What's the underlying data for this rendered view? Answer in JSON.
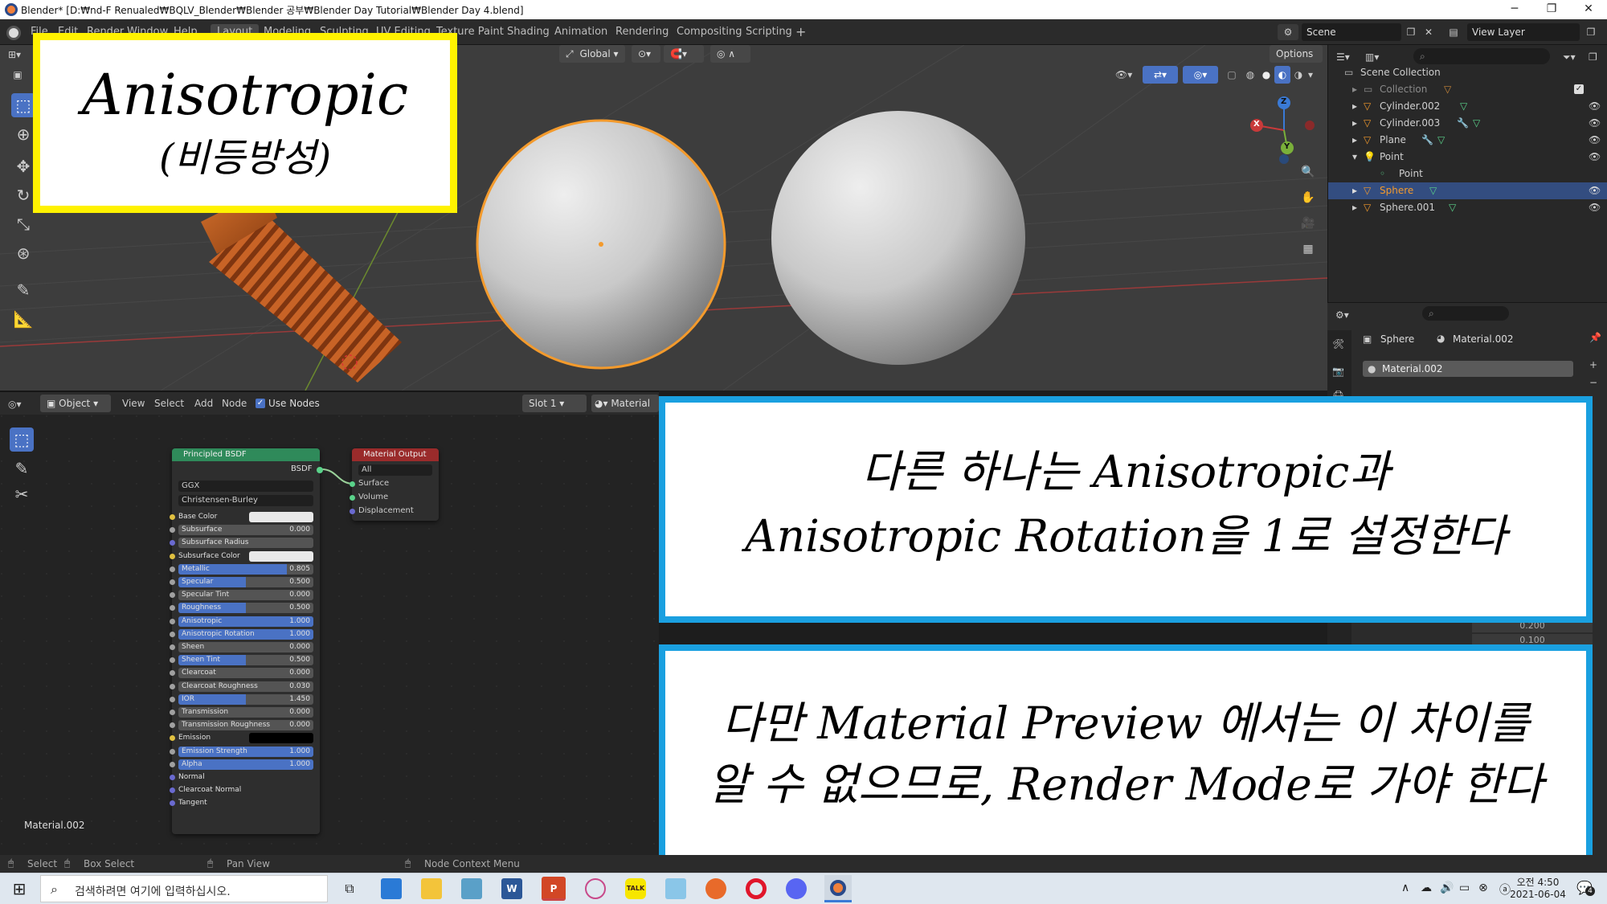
{
  "window": {
    "title": "Blender* [D:₩nd-F Renualed₩BQLV_Blender₩Blender 공부₩Blender Day Tutorial₩Blender Day 4.blend]",
    "minimize": "─",
    "maximize": "❐",
    "close": "✕"
  },
  "topbar": {
    "menus": [
      "File",
      "Edit",
      "Render",
      "Window",
      "Help"
    ],
    "workspaces": [
      "Layout",
      "Modeling",
      "Sculpting",
      "UV Editing",
      "Texture Paint",
      "Shading",
      "Animation",
      "Rendering",
      "Compositing",
      "Scripting"
    ],
    "add_tab": "+",
    "scene": "Scene",
    "view_layer": "View Layer"
  },
  "viewport": {
    "transform_orientation": "Global",
    "options": "Options",
    "gizmo": {
      "x": "X",
      "y": "Y",
      "z": "Z"
    }
  },
  "outliner": {
    "items": [
      {
        "label": "Scene Collection"
      },
      {
        "label": "Collection"
      },
      {
        "label": "Cylinder.002"
      },
      {
        "label": "Cylinder.003"
      },
      {
        "label": "Plane"
      },
      {
        "label": "Point"
      },
      {
        "label": "Point"
      },
      {
        "label": "Sphere"
      },
      {
        "label": "Sphere.001"
      }
    ]
  },
  "properties": {
    "object": "Sphere",
    "material": "Material.002",
    "slot": "Material.002",
    "values": [
      "0.200",
      "0.100"
    ]
  },
  "node_editor": {
    "mode": "Object",
    "menus": [
      "View",
      "Select",
      "Add",
      "Node"
    ],
    "use_nodes": "Use Nodes",
    "slot": "Slot 1",
    "material": "Material",
    "material_name": "Material.002",
    "bsdf": {
      "title": "Principled BSDF",
      "output": "BSDF",
      "distribution": "GGX",
      "subsurface_method": "Christensen-Burley",
      "rows": [
        {
          "label": "Base Color",
          "value": ""
        },
        {
          "label": "Subsurface",
          "value": "0.000"
        },
        {
          "label": "Subsurface Radius",
          "value": ""
        },
        {
          "label": "Subsurface Color",
          "value": ""
        },
        {
          "label": "Metallic",
          "value": "0.805"
        },
        {
          "label": "Specular",
          "value": "0.500"
        },
        {
          "label": "Specular Tint",
          "value": "0.000"
        },
        {
          "label": "Roughness",
          "value": "0.500"
        },
        {
          "label": "Anisotropic",
          "value": "1.000"
        },
        {
          "label": "Anisotropic Rotation",
          "value": "1.000"
        },
        {
          "label": "Sheen",
          "value": "0.000"
        },
        {
          "label": "Sheen Tint",
          "value": "0.500"
        },
        {
          "label": "Clearcoat",
          "value": "0.000"
        },
        {
          "label": "Clearcoat Roughness",
          "value": "0.030"
        },
        {
          "label": "IOR",
          "value": "1.450"
        },
        {
          "label": "Transmission",
          "value": "0.000"
        },
        {
          "label": "Transmission Roughness",
          "value": "0.000"
        },
        {
          "label": "Emission",
          "value": ""
        },
        {
          "label": "Emission Strength",
          "value": "1.000"
        },
        {
          "label": "Alpha",
          "value": "1.000"
        },
        {
          "label": "Normal",
          "value": ""
        },
        {
          "label": "Clearcoat Normal",
          "value": ""
        },
        {
          "label": "Tangent",
          "value": ""
        }
      ]
    },
    "output_node": {
      "title": "Material Output",
      "target": "All",
      "inputs": [
        "Surface",
        "Volume",
        "Displacement"
      ]
    }
  },
  "overlays": {
    "title_line1": "Anisotropic",
    "title_line2": "(비등방성)",
    "note1_line1": "다른 하나는 Anisotropic과",
    "note1_line2": "Anisotropic Rotation을 1로 설정한다",
    "note2_line1": "다만 Material Preview 에서는 이 차이를",
    "note2_line2": "알 수 없으므로, Render Mode로 가야 한다"
  },
  "statusbar": {
    "select": "Select",
    "box_select": "Box Select",
    "pan_view": "Pan View",
    "context_menu": "Node Context Menu"
  },
  "taskbar": {
    "search_placeholder": "검색하려면 여기에 입력하십시오.",
    "clock_line1": "오전 4:50",
    "clock_line2": "2021-06-04",
    "notification_count": "4"
  },
  "colors": {
    "accent_orange": "#f39a2c",
    "title_box_border": "#fff200",
    "note_box_border": "#1aa0e0",
    "node_header_bsdf": "#2f8a5a",
    "node_header_output": "#9a2b2b",
    "slider_blue": "#4a72c4",
    "selected_row": "#334d80"
  }
}
